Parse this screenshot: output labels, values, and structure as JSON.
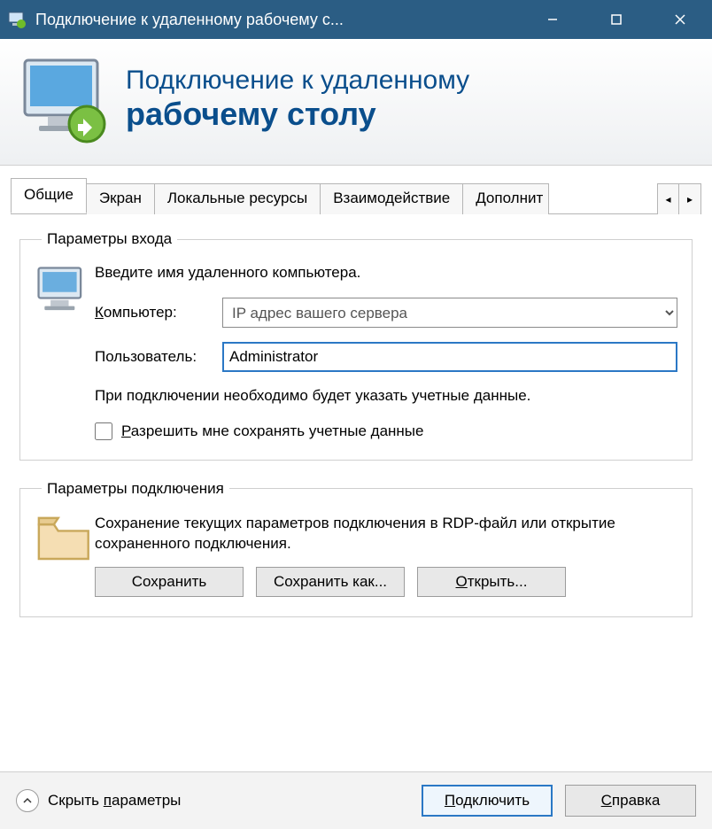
{
  "window": {
    "title": "Подключение к удаленному рабочему с..."
  },
  "header": {
    "line1": "Подключение к удаленному",
    "line2": "рабочему столу"
  },
  "tabs": [
    {
      "label": "Общие",
      "active": true
    },
    {
      "label": "Экран",
      "active": false
    },
    {
      "label": "Локальные ресурсы",
      "active": false
    },
    {
      "label": "Взаимодействие",
      "active": false
    },
    {
      "label": "Дополнит",
      "active": false
    }
  ],
  "login_group": {
    "legend": "Параметры входа",
    "instruction": "Введите имя удаленного компьютера.",
    "computer_label_pre": "К",
    "computer_label_rest": "омпьютер:",
    "computer_value": "IP адрес вашего сервера",
    "user_label": "Пользователь:",
    "user_value": "Administrator",
    "hint": "При подключении необходимо будет указать учетные данные.",
    "remember_pre": "Р",
    "remember_rest": "азрешить мне сохранять учетные данные"
  },
  "conn_group": {
    "legend": "Параметры подключения",
    "text": "Сохранение текущих параметров подключения в RDP-файл или открытие сохраненного подключения.",
    "save": "Сохранить",
    "save_as": "Сохранить как...",
    "open_pre": "О",
    "open_rest": "ткрыть..."
  },
  "footer": {
    "hide_pre": "Скрыть ",
    "hide_u": "п",
    "hide_rest": "араметры",
    "connect_pre": "П",
    "connect_rest": "одключить",
    "help_pre": "С",
    "help_rest": "правка"
  }
}
